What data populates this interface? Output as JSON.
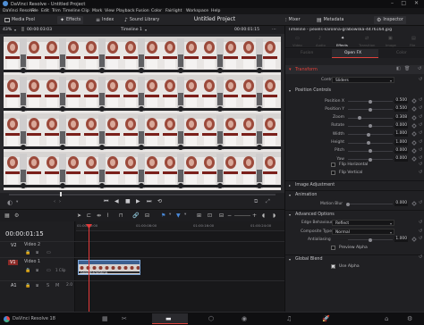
{
  "app": {
    "window_title": "DaVinci Resolve - Untitled Project",
    "menus": [
      "DaVinci Resolve",
      "File",
      "Edit",
      "Trim",
      "Timeline",
      "Clip",
      "Mark",
      "View",
      "Playback",
      "Fusion",
      "Color",
      "Fairlight",
      "Workspace",
      "Help"
    ],
    "project_title": "Untitled Project"
  },
  "toolbar": {
    "media_pool": "Media Pool",
    "effects": "Effects",
    "index": "Index",
    "sound_library": "Sound Library",
    "mixer": "Mixer",
    "metadata": "Metadata",
    "inspector": "Inspector"
  },
  "viewer": {
    "zoom": "43%",
    "source_tc": "00:00:03:03",
    "timeline_name": "Timeline 1",
    "record_tc": "00:00:01:15"
  },
  "timeline": {
    "timecode": "00:00:01:15",
    "ruler": [
      "01:00:00:00",
      "01:00:08:00",
      "01:00:16:00",
      "01:00:24:00"
    ],
    "tracks": [
      {
        "id": "V2",
        "name": "Video 2"
      },
      {
        "id": "V1",
        "name": "Video 1",
        "clip_count": "1 Clip"
      },
      {
        "id": "A1",
        "name": "",
        "level": "2.0"
      }
    ],
    "clip_label": "pexels-karolina"
  },
  "inspector": {
    "clip_title": "Timeline - pexels-karolina-grabowska-4476164.jpg",
    "top_tabs": [
      "Video",
      "Audio",
      "Effects",
      "Transition",
      "Image",
      "File"
    ],
    "active_top_tab": "Effects",
    "sub_tabs": [
      "Fusion",
      "Open FX",
      "Color"
    ],
    "active_sub_tab": "Open FX",
    "effect_title": "Transform",
    "control_mode_label": "Control Mode",
    "control_mode_value": "Sliders",
    "sections": {
      "position_controls": "Position Controls",
      "image_adjustment": "Image Adjustment",
      "animation": "Animation",
      "advanced_options": "Advanced Options",
      "global_blend": "Global Blend"
    },
    "params": [
      {
        "label": "Position X",
        "value": "0.500",
        "level": 0.5
      },
      {
        "label": "Position Y",
        "value": "0.500",
        "level": 0.5
      },
      {
        "label": "Zoom",
        "value": "0.308",
        "level": 0.25
      },
      {
        "label": "Rotate",
        "value": "0.000",
        "level": 0.5
      },
      {
        "label": "Width",
        "value": "1.000",
        "level": 0.45
      },
      {
        "label": "Height",
        "value": "1.000",
        "level": 0.45
      },
      {
        "label": "Pitch",
        "value": "0.000",
        "level": 0.5
      },
      {
        "label": "Yaw",
        "value": "0.000",
        "level": 0.5
      }
    ],
    "flip_horizontal": "Flip Horizontal",
    "flip_vertical": "Flip Vertical",
    "motion_blur_label": "Motion Blur",
    "motion_blur_value": "0.000",
    "edge_behaviour_label": "Edge Behaviour",
    "edge_behaviour_value": "Reflect",
    "composite_type_label": "Composite Type",
    "composite_type_value": "Normal",
    "antialiasing_label": "Antialiasing",
    "antialiasing_value": "1.000",
    "preview_alpha": "Preview Alpha",
    "use_alpha": "Use Alpha"
  },
  "statusbar": {
    "app_name": "DaVinci Resolve 18"
  },
  "colors": {
    "accent_red": "#e0413a",
    "clip_blue": "#4a78b8",
    "playhead": "#e53a3a"
  }
}
